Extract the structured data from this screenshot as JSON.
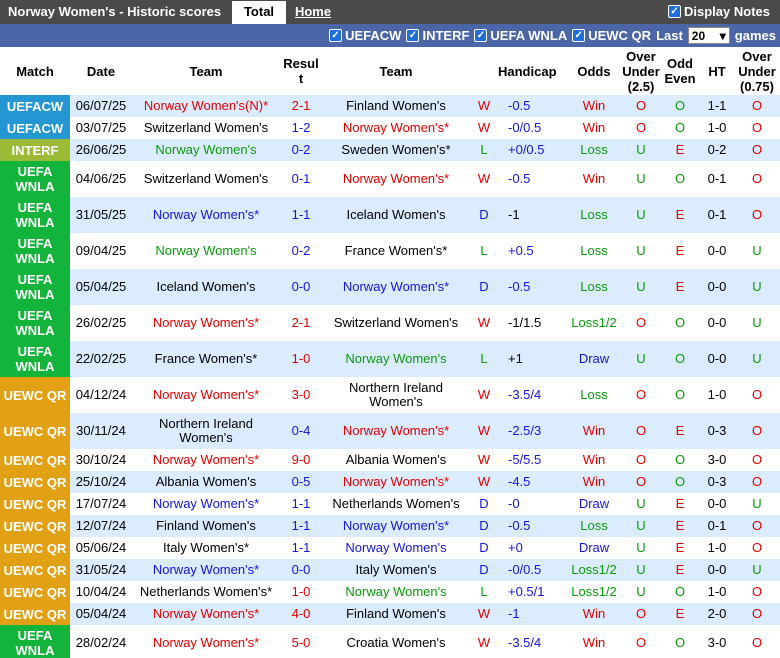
{
  "header": {
    "title": "Norway Women's - Historic scores",
    "tab_total": "Total",
    "tab_home": "Home",
    "display_notes": "Display Notes"
  },
  "filters": {
    "items": [
      "UEFACW",
      "INTERF",
      "UEFA WNLA",
      "UEWC QR"
    ],
    "last_label": "Last",
    "last_value": "20",
    "games_label": "games"
  },
  "colors": {
    "UEFACW": "#2496d2",
    "INTERF": "#9bbb37",
    "UEFA WNLA": "#12b43b",
    "UEWC QR": "#e2a114",
    "row_alt": "#dcecff",
    "red": "#e00000",
    "blue": "#1515e0",
    "green": "#0a9a0a"
  },
  "columns": [
    "Match",
    "Date",
    "Team",
    "Result",
    "Team",
    "Handicap",
    "Odds",
    "Over Under (2.5)",
    "Odd Even",
    "HT",
    "Over Under (0.75)"
  ],
  "columns_display": {
    "result": [
      "Resul",
      "t"
    ],
    "ou25": [
      "Over",
      "Under",
      "(2.5)"
    ],
    "oddeven": [
      "Odd",
      "Even"
    ],
    "ou075": [
      "Over",
      "Under",
      "(0.75)"
    ]
  },
  "rows": [
    {
      "match": "UEFACW",
      "date": "06/07/25",
      "home": "Norway Women's(N)*",
      "home_c": "red",
      "score": "2-1",
      "score_c": "red",
      "away": "Finland Women's",
      "away_c": "blk",
      "res": "W",
      "res_c": "red",
      "hcp": "-0.5",
      "hcp_c": "blue",
      "odds": "Win",
      "odds_c": "red",
      "ou": "O",
      "ou_c": "red",
      "oe": "O",
      "oe_c": "green",
      "ht": "1-1",
      "ht_c": "blk",
      "ou2": "O",
      "ou2_c": "red",
      "tall": false
    },
    {
      "match": "UEFACW",
      "date": "03/07/25",
      "home": "Switzerland Women's",
      "home_c": "blk",
      "score": "1-2",
      "score_c": "blue",
      "away": "Norway Women's*",
      "away_c": "red",
      "res": "W",
      "res_c": "red",
      "hcp": "-0/0.5",
      "hcp_c": "blue",
      "odds": "Win",
      "odds_c": "red",
      "ou": "O",
      "ou_c": "red",
      "oe": "O",
      "oe_c": "green",
      "ht": "1-0",
      "ht_c": "blk",
      "ou2": "O",
      "ou2_c": "red",
      "tall": false
    },
    {
      "match": "INTERF",
      "date": "26/06/25",
      "home": "Norway Women's",
      "home_c": "green",
      "score": "0-2",
      "score_c": "blue",
      "away": "Sweden Women's*",
      "away_c": "blk",
      "res": "L",
      "res_c": "green",
      "hcp": "+0/0.5",
      "hcp_c": "blue",
      "odds": "Loss",
      "odds_c": "green",
      "ou": "U",
      "ou_c": "green",
      "oe": "E",
      "oe_c": "red",
      "ht": "0-2",
      "ht_c": "blk",
      "ou2": "O",
      "ou2_c": "red",
      "tall": false
    },
    {
      "match": "UEFA WNLA",
      "date": "04/06/25",
      "home": "Switzerland Women's",
      "home_c": "blk",
      "score": "0-1",
      "score_c": "blue",
      "away": "Norway Women's*",
      "away_c": "red",
      "res": "W",
      "res_c": "red",
      "hcp": "-0.5",
      "hcp_c": "blue",
      "odds": "Win",
      "odds_c": "red",
      "ou": "U",
      "ou_c": "green",
      "oe": "O",
      "oe_c": "green",
      "ht": "0-1",
      "ht_c": "blk",
      "ou2": "O",
      "ou2_c": "red",
      "tall": true
    },
    {
      "match": "UEFA WNLA",
      "date": "31/05/25",
      "home": "Norway Women's*",
      "home_c": "blue",
      "score": "1-1",
      "score_c": "blue",
      "away": "Iceland Women's",
      "away_c": "blk",
      "res": "D",
      "res_c": "blue",
      "hcp": "-1",
      "hcp_c": "blk",
      "odds": "Loss",
      "odds_c": "green",
      "ou": "U",
      "ou_c": "green",
      "oe": "E",
      "oe_c": "red",
      "ht": "0-1",
      "ht_c": "blk",
      "ou2": "O",
      "ou2_c": "red",
      "tall": true
    },
    {
      "match": "UEFA WNLA",
      "date": "09/04/25",
      "home": "Norway Women's",
      "home_c": "green",
      "score": "0-2",
      "score_c": "blue",
      "away": "France Women's*",
      "away_c": "blk",
      "res": "L",
      "res_c": "green",
      "hcp": "+0.5",
      "hcp_c": "blue",
      "odds": "Loss",
      "odds_c": "green",
      "ou": "U",
      "ou_c": "green",
      "oe": "E",
      "oe_c": "red",
      "ht": "0-0",
      "ht_c": "blk",
      "ou2": "U",
      "ou2_c": "green",
      "tall": true
    },
    {
      "match": "UEFA WNLA",
      "date": "05/04/25",
      "home": "Iceland Women's",
      "home_c": "blk",
      "score": "0-0",
      "score_c": "blue",
      "away": "Norway Women's*",
      "away_c": "blue",
      "res": "D",
      "res_c": "blue",
      "hcp": "-0.5",
      "hcp_c": "blue",
      "odds": "Loss",
      "odds_c": "green",
      "ou": "U",
      "ou_c": "green",
      "oe": "E",
      "oe_c": "red",
      "ht": "0-0",
      "ht_c": "blk",
      "ou2": "U",
      "ou2_c": "green",
      "tall": true
    },
    {
      "match": "UEFA WNLA",
      "date": "26/02/25",
      "home": "Norway Women's*",
      "home_c": "red",
      "score": "2-1",
      "score_c": "red",
      "away": "Switzerland Women's",
      "away_c": "blk",
      "res": "W",
      "res_c": "red",
      "hcp": "-1/1.5",
      "hcp_c": "blk",
      "odds": "Loss1/2",
      "odds_c": "green",
      "ou": "O",
      "ou_c": "red",
      "oe": "O",
      "oe_c": "green",
      "ht": "0-0",
      "ht_c": "blk",
      "ou2": "U",
      "ou2_c": "green",
      "tall": true
    },
    {
      "match": "UEFA WNLA",
      "date": "22/02/25",
      "home": "France Women's*",
      "home_c": "blk",
      "score": "1-0",
      "score_c": "red",
      "away": "Norway Women's",
      "away_c": "green",
      "res": "L",
      "res_c": "green",
      "hcp": "+1",
      "hcp_c": "blk",
      "odds": "Draw",
      "odds_c": "blue",
      "ou": "U",
      "ou_c": "green",
      "oe": "O",
      "oe_c": "green",
      "ht": "0-0",
      "ht_c": "blk",
      "ou2": "U",
      "ou2_c": "green",
      "tall": true
    },
    {
      "match": "UEWC QR",
      "date": "04/12/24",
      "home": "Norway Women's*",
      "home_c": "red",
      "score": "3-0",
      "score_c": "red",
      "away": "Northern Ireland Women's",
      "away_c": "blk",
      "res": "W",
      "res_c": "red",
      "hcp": "-3.5/4",
      "hcp_c": "blue",
      "odds": "Loss",
      "odds_c": "green",
      "ou": "O",
      "ou_c": "red",
      "oe": "O",
      "oe_c": "green",
      "ht": "1-0",
      "ht_c": "blk",
      "ou2": "O",
      "ou2_c": "red",
      "tall": true
    },
    {
      "match": "UEWC QR",
      "date": "30/11/24",
      "home": "Northern Ireland Women's",
      "home_c": "blk",
      "score": "0-4",
      "score_c": "blue",
      "away": "Norway Women's*",
      "away_c": "red",
      "res": "W",
      "res_c": "red",
      "hcp": "-2.5/3",
      "hcp_c": "blue",
      "odds": "Win",
      "odds_c": "red",
      "ou": "O",
      "ou_c": "red",
      "oe": "E",
      "oe_c": "red",
      "ht": "0-3",
      "ht_c": "blk",
      "ou2": "O",
      "ou2_c": "red",
      "tall": true
    },
    {
      "match": "UEWC QR",
      "date": "30/10/24",
      "home": "Norway Women's*",
      "home_c": "red",
      "score": "9-0",
      "score_c": "red",
      "away": "Albania Women's",
      "away_c": "blk",
      "res": "W",
      "res_c": "red",
      "hcp": "-5/5.5",
      "hcp_c": "blue",
      "odds": "Win",
      "odds_c": "red",
      "ou": "O",
      "ou_c": "red",
      "oe": "O",
      "oe_c": "green",
      "ht": "3-0",
      "ht_c": "blk",
      "ou2": "O",
      "ou2_c": "red",
      "tall": false
    },
    {
      "match": "UEWC QR",
      "date": "25/10/24",
      "home": "Albania Women's",
      "home_c": "blk",
      "score": "0-5",
      "score_c": "blue",
      "away": "Norway Women's*",
      "away_c": "red",
      "res": "W",
      "res_c": "red",
      "hcp": "-4.5",
      "hcp_c": "blue",
      "odds": "Win",
      "odds_c": "red",
      "ou": "O",
      "ou_c": "red",
      "oe": "O",
      "oe_c": "green",
      "ht": "0-3",
      "ht_c": "blk",
      "ou2": "O",
      "ou2_c": "red",
      "tall": false
    },
    {
      "match": "UEWC QR",
      "date": "17/07/24",
      "home": "Norway Women's*",
      "home_c": "blue",
      "score": "1-1",
      "score_c": "blue",
      "away": "Netherlands Women's",
      "away_c": "blk",
      "res": "D",
      "res_c": "blue",
      "hcp": "-0",
      "hcp_c": "blue",
      "odds": "Draw",
      "odds_c": "blue",
      "ou": "U",
      "ou_c": "green",
      "oe": "E",
      "oe_c": "red",
      "ht": "0-0",
      "ht_c": "blk",
      "ou2": "U",
      "ou2_c": "green",
      "tall": false
    },
    {
      "match": "UEWC QR",
      "date": "12/07/24",
      "home": "Finland Women's",
      "home_c": "blk",
      "score": "1-1",
      "score_c": "blue",
      "away": "Norway Women's*",
      "away_c": "blue",
      "res": "D",
      "res_c": "blue",
      "hcp": "-0.5",
      "hcp_c": "blue",
      "odds": "Loss",
      "odds_c": "green",
      "ou": "U",
      "ou_c": "green",
      "oe": "E",
      "oe_c": "red",
      "ht": "0-1",
      "ht_c": "blk",
      "ou2": "O",
      "ou2_c": "red",
      "tall": false
    },
    {
      "match": "UEWC QR",
      "date": "05/06/24",
      "home": "Italy Women's*",
      "home_c": "blk",
      "score": "1-1",
      "score_c": "blue",
      "away": "Norway Women's",
      "away_c": "blue",
      "res": "D",
      "res_c": "blue",
      "hcp": "+0",
      "hcp_c": "blue",
      "odds": "Draw",
      "odds_c": "blue",
      "ou": "U",
      "ou_c": "green",
      "oe": "E",
      "oe_c": "red",
      "ht": "1-0",
      "ht_c": "blk",
      "ou2": "O",
      "ou2_c": "red",
      "tall": false
    },
    {
      "match": "UEWC QR",
      "date": "31/05/24",
      "home": "Norway Women's*",
      "home_c": "blue",
      "score": "0-0",
      "score_c": "blue",
      "away": "Italy Women's",
      "away_c": "blk",
      "res": "D",
      "res_c": "blue",
      "hcp": "-0/0.5",
      "hcp_c": "blue",
      "odds": "Loss1/2",
      "odds_c": "green",
      "ou": "U",
      "ou_c": "green",
      "oe": "E",
      "oe_c": "red",
      "ht": "0-0",
      "ht_c": "blk",
      "ou2": "U",
      "ou2_c": "green",
      "tall": false
    },
    {
      "match": "UEWC QR",
      "date": "10/04/24",
      "home": "Netherlands Women's*",
      "home_c": "blk",
      "score": "1-0",
      "score_c": "red",
      "away": "Norway Women's",
      "away_c": "green",
      "res": "L",
      "res_c": "green",
      "hcp": "+0.5/1",
      "hcp_c": "blue",
      "odds": "Loss1/2",
      "odds_c": "green",
      "ou": "U",
      "ou_c": "green",
      "oe": "O",
      "oe_c": "green",
      "ht": "1-0",
      "ht_c": "blk",
      "ou2": "O",
      "ou2_c": "red",
      "tall": false
    },
    {
      "match": "UEWC QR",
      "date": "05/04/24",
      "home": "Norway Women's*",
      "home_c": "red",
      "score": "4-0",
      "score_c": "red",
      "away": "Finland Women's",
      "away_c": "blk",
      "res": "W",
      "res_c": "red",
      "hcp": "-1",
      "hcp_c": "blue",
      "odds": "Win",
      "odds_c": "red",
      "ou": "O",
      "ou_c": "red",
      "oe": "E",
      "oe_c": "red",
      "ht": "2-0",
      "ht_c": "blk",
      "ou2": "O",
      "ou2_c": "red",
      "tall": false
    },
    {
      "match": "UEFA WNLA",
      "date": "28/02/24",
      "home": "Norway Women's*",
      "home_c": "red",
      "score": "5-0",
      "score_c": "red",
      "away": "Croatia Women's",
      "away_c": "blk",
      "res": "W",
      "res_c": "red",
      "hcp": "-3.5/4",
      "hcp_c": "blue",
      "odds": "Win",
      "odds_c": "red",
      "ou": "O",
      "ou_c": "red",
      "oe": "O",
      "oe_c": "green",
      "ht": "3-0",
      "ht_c": "blk",
      "ou2": "O",
      "ou2_c": "red",
      "tall": true
    }
  ]
}
